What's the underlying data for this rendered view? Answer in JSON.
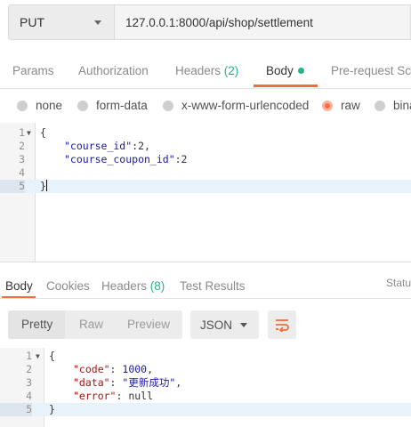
{
  "request": {
    "method": "PUT",
    "url": "127.0.0.1:8000/api/shop/settlement"
  },
  "request_tabs": [
    {
      "label": "Params"
    },
    {
      "label": "Authorization"
    },
    {
      "label": "Headers",
      "count": "(2)"
    },
    {
      "label": "Body",
      "active": true
    },
    {
      "label": "Pre-request Scr"
    }
  ],
  "body_types": [
    {
      "label": "none"
    },
    {
      "label": "form-data"
    },
    {
      "label": "x-www-form-urlencoded"
    },
    {
      "label": "raw",
      "selected": true
    },
    {
      "label": "bina"
    }
  ],
  "request_body": {
    "lines": [
      {
        "n": "1",
        "text": "{"
      },
      {
        "n": "2",
        "key": "\"course_id\"",
        "rest": ":2,"
      },
      {
        "n": "3",
        "key": "\"course_coupon_id\"",
        "rest": ":2"
      },
      {
        "n": "4",
        "text": ""
      },
      {
        "n": "5",
        "text": "}"
      }
    ]
  },
  "response_tabs": [
    {
      "label": "Body",
      "active": true
    },
    {
      "label": "Cookies"
    },
    {
      "label": "Headers",
      "count": "(8)"
    },
    {
      "label": "Test Results"
    }
  ],
  "response_status_label": "Status",
  "response_view": {
    "modes": [
      "Pretty",
      "Raw",
      "Preview"
    ],
    "active_mode": "Pretty",
    "format": "JSON"
  },
  "response_body": {
    "lines": [
      {
        "n": "1",
        "text": "{"
      },
      {
        "n": "2",
        "key": "\"code\"",
        "sep": ": ",
        "value": "1000",
        "tail": ","
      },
      {
        "n": "3",
        "key": "\"data\"",
        "sep": ": ",
        "value": "\"更新成功\"",
        "tail": ","
      },
      {
        "n": "4",
        "key": "\"error\"",
        "sep": ": ",
        "value": "null",
        "tail": ""
      },
      {
        "n": "5",
        "text": "}"
      }
    ]
  },
  "colors": {
    "accent": "#f26b3a",
    "count_green": "#26b47f",
    "string_blue": "#1a1aa6",
    "key_red": "#a11"
  },
  "icons": {
    "method_dropdown": "caret-down-icon",
    "format_dropdown": "caret-down-icon",
    "wrap": "wrap-lines-icon",
    "fold": "fold-triangle-icon"
  }
}
